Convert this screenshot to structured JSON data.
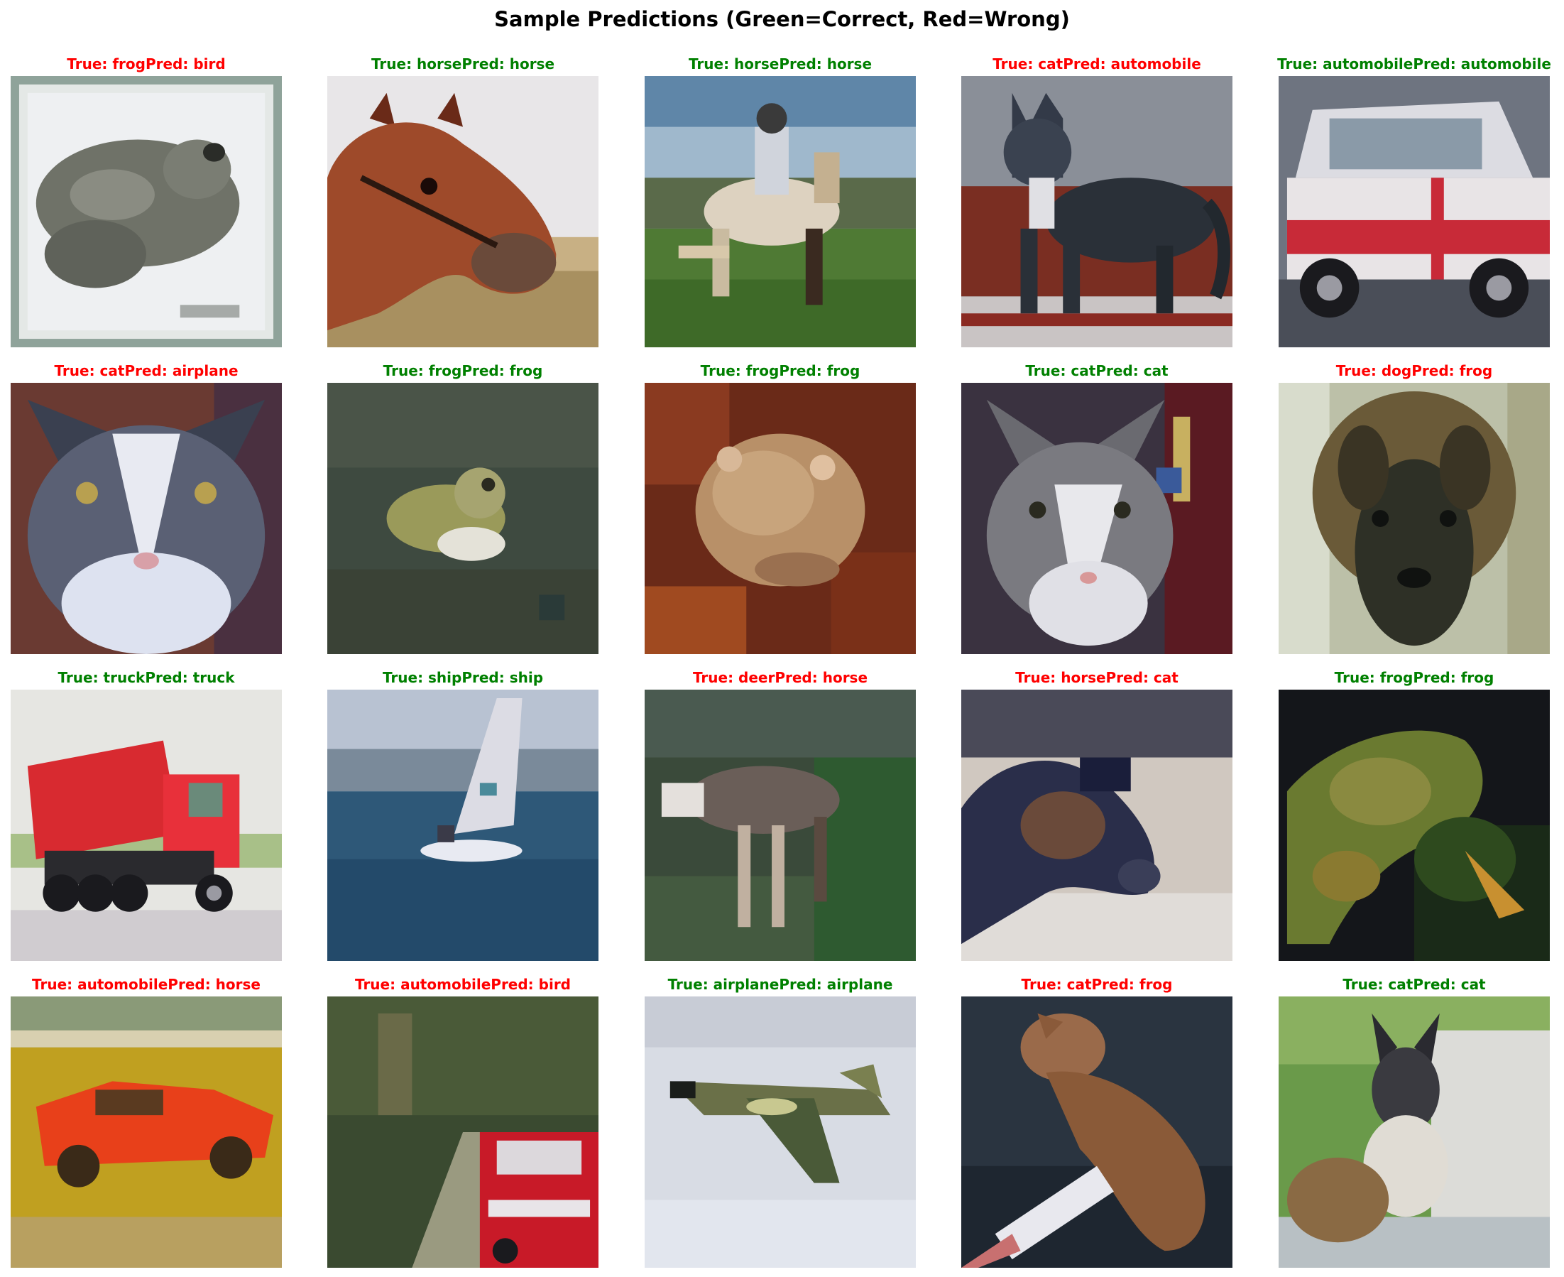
{
  "title": "Sample Predictions (Green=Correct, Red=Wrong)",
  "colors": {
    "correct": "#008000",
    "wrong": "#ff0000"
  },
  "samples": [
    {
      "title": "True: frogPred: bird",
      "true_label": "frog",
      "pred_label": "bird",
      "correct": false,
      "depiction": "grey frog on white background"
    },
    {
      "title": "True: horsePred: horse",
      "true_label": "horse",
      "pred_label": "horse",
      "correct": true,
      "depiction": "brown horse head close-up"
    },
    {
      "title": "True: horsePred: horse",
      "true_label": "horse",
      "pred_label": "horse",
      "correct": true,
      "depiction": "rider on white horse on grass"
    },
    {
      "title": "True: catPred: automobile",
      "true_label": "cat",
      "pred_label": "automobile",
      "correct": false,
      "depiction": "dark cat standing on red ledge"
    },
    {
      "title": "True: automobilePred: automobile",
      "true_label": "automobile",
      "pred_label": "automobile",
      "correct": true,
      "depiction": "white and red car"
    },
    {
      "title": "True: catPred: airplane",
      "true_label": "cat",
      "pred_label": "airplane",
      "correct": false,
      "depiction": "grey and white cat face"
    },
    {
      "title": "True: frogPred: frog",
      "true_label": "frog",
      "pred_label": "frog",
      "correct": true,
      "depiction": "frog on dark green ground"
    },
    {
      "title": "True: frogPred: frog",
      "true_label": "frog",
      "pred_label": "frog",
      "correct": true,
      "depiction": "brown toad among red leaves"
    },
    {
      "title": "True: catPred: cat",
      "true_label": "cat",
      "pred_label": "cat",
      "correct": true,
      "depiction": "grey and white cat"
    },
    {
      "title": "True: dogPred: frog",
      "true_label": "dog",
      "pred_label": "frog",
      "correct": false,
      "depiction": "dark dog face"
    },
    {
      "title": "True: truckPred: truck",
      "true_label": "truck",
      "pred_label": "truck",
      "correct": true,
      "depiction": "red dump truck"
    },
    {
      "title": "True: shipPred: ship",
      "true_label": "ship",
      "pred_label": "ship",
      "correct": true,
      "depiction": "sailboat on blue water"
    },
    {
      "title": "True: deerPred: horse",
      "true_label": "deer",
      "pred_label": "horse",
      "correct": false,
      "depiction": "deer among green plants"
    },
    {
      "title": "True: horsePred: cat",
      "true_label": "horse",
      "pred_label": "cat",
      "correct": false,
      "depiction": "dark horse head"
    },
    {
      "title": "True: frogPred: frog",
      "true_label": "frog",
      "pred_label": "frog",
      "correct": true,
      "depiction": "green frog on dark background"
    },
    {
      "title": "True: automobilePred: horse",
      "true_label": "automobile",
      "pred_label": "horse",
      "correct": false,
      "depiction": "red sports car on yellow page"
    },
    {
      "title": "True: automobilePred: bird",
      "true_label": "automobile",
      "pred_label": "bird",
      "correct": false,
      "depiction": "red car on forest road"
    },
    {
      "title": "True: airplanePred: airplane",
      "true_label": "airplane",
      "pred_label": "airplane",
      "correct": true,
      "depiction": "camouflage jet in sky"
    },
    {
      "title": "True: catPred: frog",
      "true_label": "cat",
      "pred_label": "frog",
      "correct": false,
      "depiction": "brown cat on dark surface"
    },
    {
      "title": "True: catPred: cat",
      "true_label": "cat",
      "pred_label": "cat",
      "correct": true,
      "depiction": "siamese cat on grass"
    }
  ]
}
